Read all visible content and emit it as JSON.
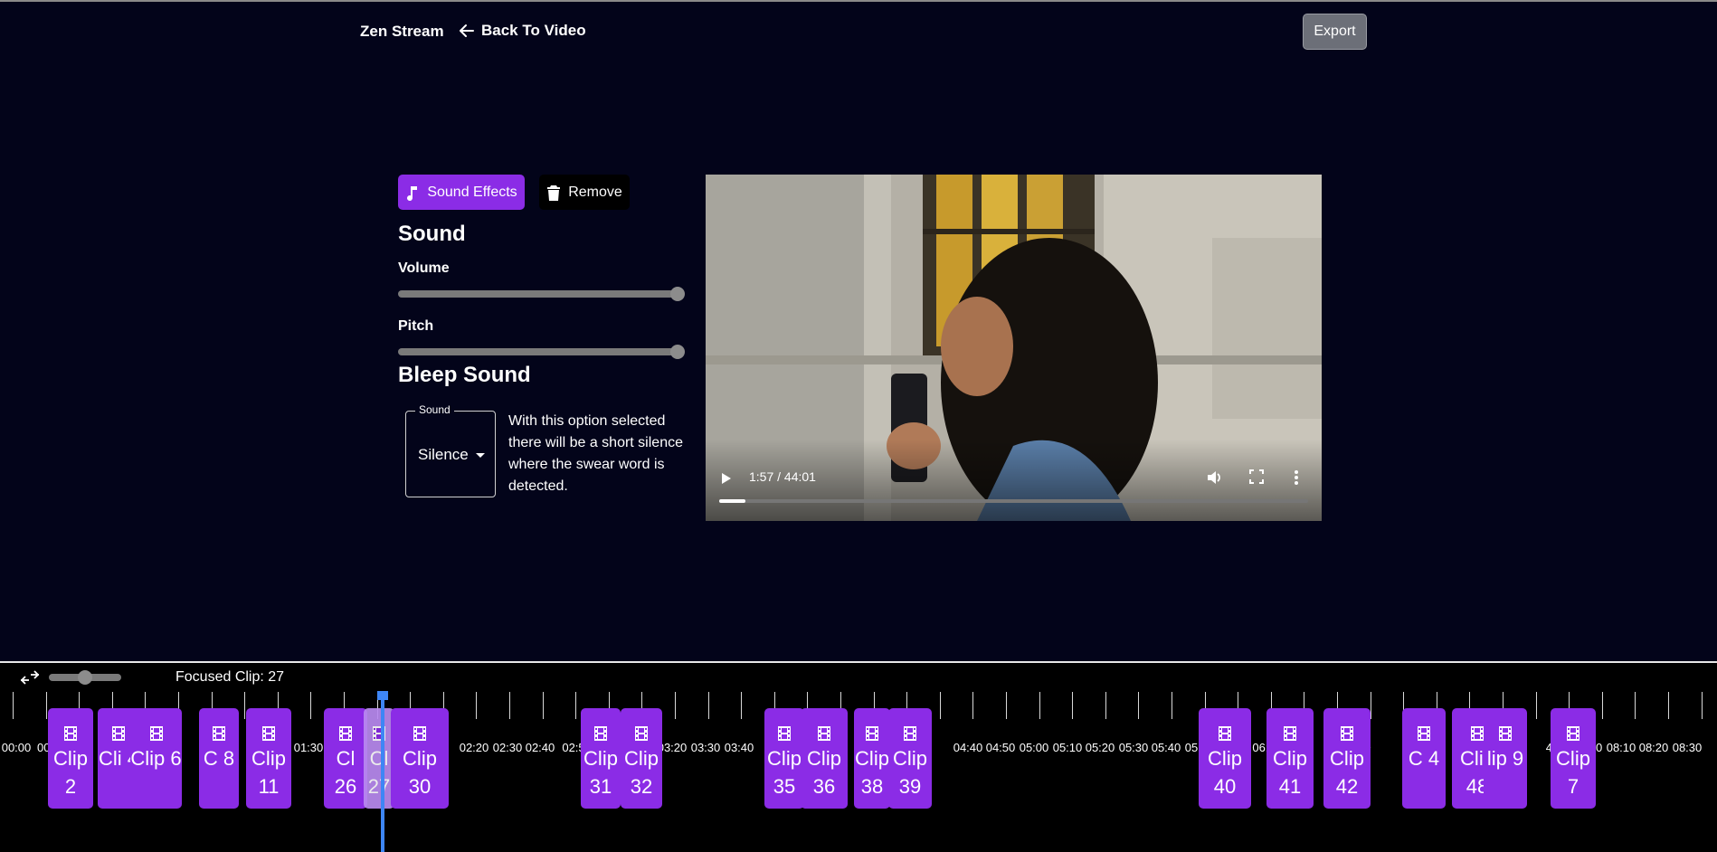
{
  "header": {
    "brand": "Zen Stream",
    "back_label": "Back To Video",
    "export_label": "Export"
  },
  "panel": {
    "tab_sound_effects": "Sound Effects",
    "tab_remove": "Remove",
    "sound_heading": "Sound",
    "volume_label": "Volume",
    "volume_value": 100,
    "pitch_label": "Pitch",
    "pitch_value": 100,
    "bleep_heading": "Bleep Sound",
    "select_legend": "Sound",
    "select_value": "Silence",
    "description": "With this option selected there will be a short silence where the swear word is detected."
  },
  "video": {
    "time": "1:57 / 44:01",
    "progress": 0.044
  },
  "timeline": {
    "focused_label": "Focused Clip: 27",
    "zoom_level": 0.45,
    "time_labels": [
      "00:00",
      "00:",
      "",
      "01:30",
      "",
      "02:20",
      "02:30",
      "02:40",
      "02:5",
      "03:20",
      "03:30",
      "03:40",
      "0",
      "04:40",
      "04:50",
      "05:00",
      "05:10",
      "05:20",
      "05:30",
      "05:40",
      "05:50",
      "06:",
      "06:2",
      "06:",
      "07:0",
      "40",
      "08:00",
      "08:10",
      "08:20",
      "08:30"
    ],
    "clips": [
      {
        "label": "Clip 2"
      },
      {
        "label": "Cli 4"
      },
      {
        "label": "Clip 6"
      },
      {
        "label": "C 8"
      },
      {
        "label": "Clip 11"
      },
      {
        "label": "Cl 26"
      },
      {
        "label": "Cl 27"
      },
      {
        "label": "Clip 30"
      },
      {
        "label": "Clip 31"
      },
      {
        "label": "Clip 32"
      },
      {
        "label": "Clip 35"
      },
      {
        "label": "Clip 36"
      },
      {
        "label": "Clip 38"
      },
      {
        "label": "Clip 39"
      },
      {
        "label": "Clip 40"
      },
      {
        "label": "Clip 41"
      },
      {
        "label": "Clip 42"
      },
      {
        "label": "C 4"
      },
      {
        "label": "Clip 48"
      },
      {
        "label": "lip 9"
      },
      {
        "label": "Clip 7"
      }
    ]
  }
}
